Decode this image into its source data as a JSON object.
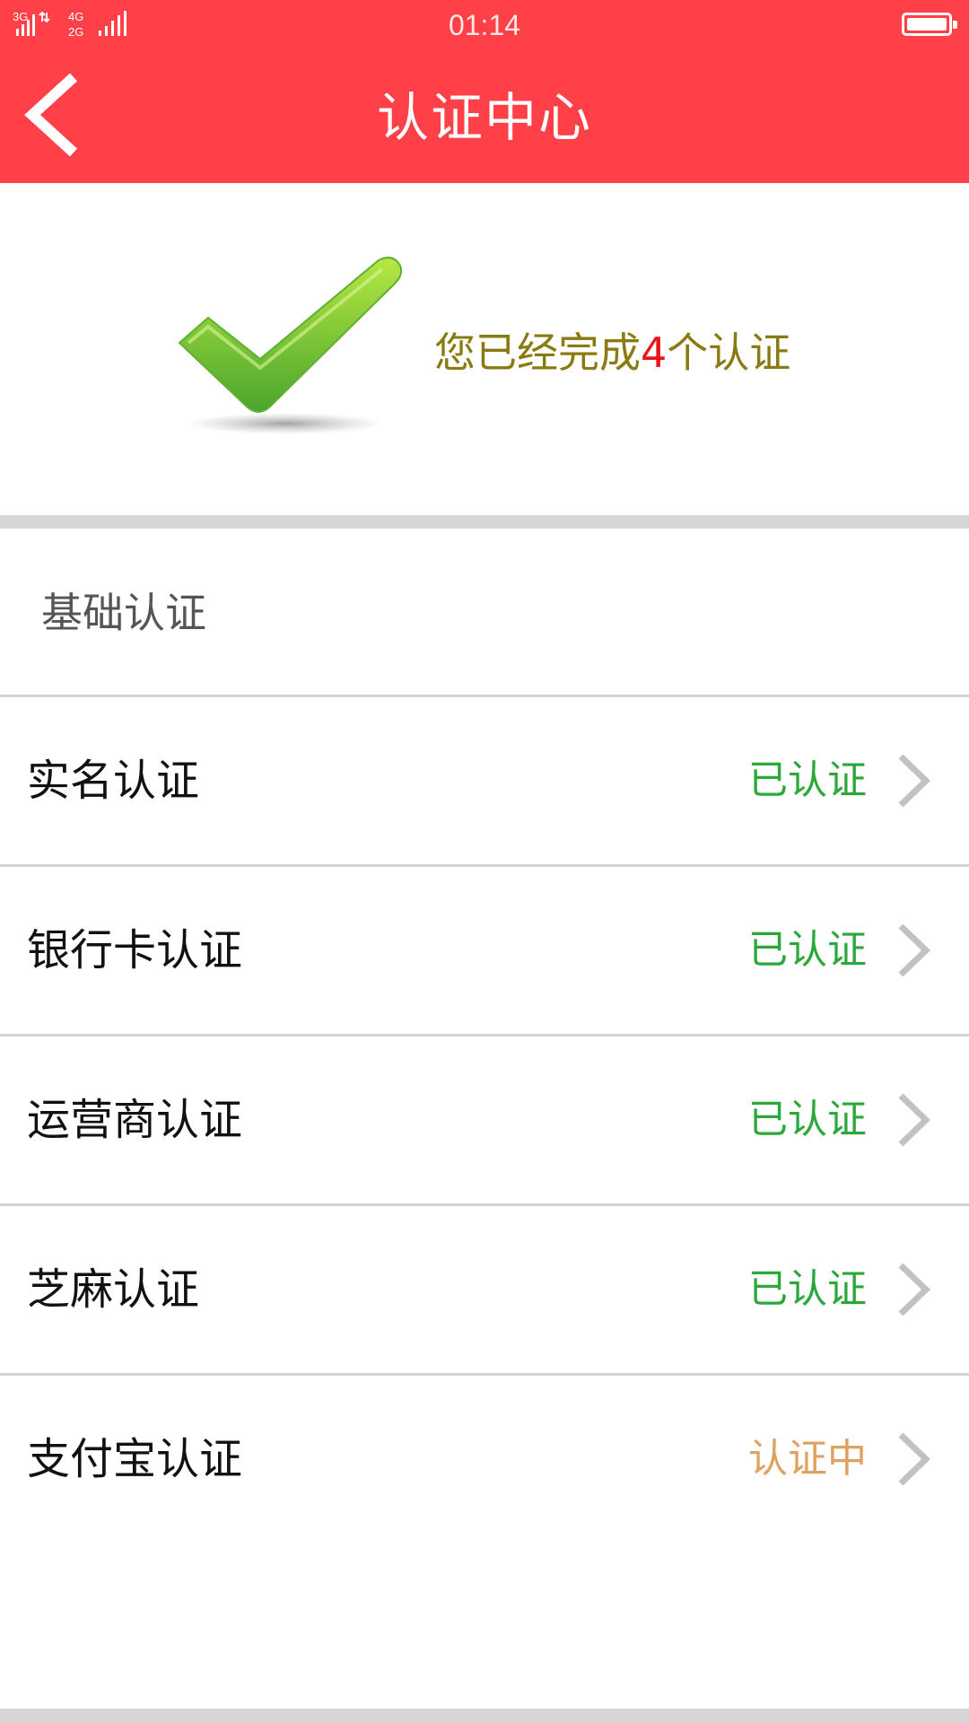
{
  "status_bar": {
    "network_left": "3G",
    "network_mid_top": "4G",
    "network_mid_bottom": "2G",
    "time": "01:14"
  },
  "header": {
    "title": "认证中心",
    "background_color": "#ff4048"
  },
  "summary": {
    "prefix": "您已经完成",
    "count": "4",
    "suffix": "个认证",
    "text_color": "#8b7a12",
    "count_color": "#e8141c"
  },
  "section": {
    "title": "基础认证"
  },
  "items": [
    {
      "label": "实名认证",
      "status": "已认证",
      "status_color": "#2aa83a"
    },
    {
      "label": "银行卡认证",
      "status": "已认证",
      "status_color": "#2aa83a"
    },
    {
      "label": "运营商认证",
      "status": "已认证",
      "status_color": "#2aa83a"
    },
    {
      "label": "芝麻认证",
      "status": "已认证",
      "status_color": "#2aa83a"
    },
    {
      "label": "支付宝认证",
      "status": "认证中",
      "status_color": "#e0a060"
    }
  ],
  "icons": {
    "back": "chevron-left-icon",
    "check": "checkmark-icon",
    "row_arrow": "chevron-right-icon"
  }
}
